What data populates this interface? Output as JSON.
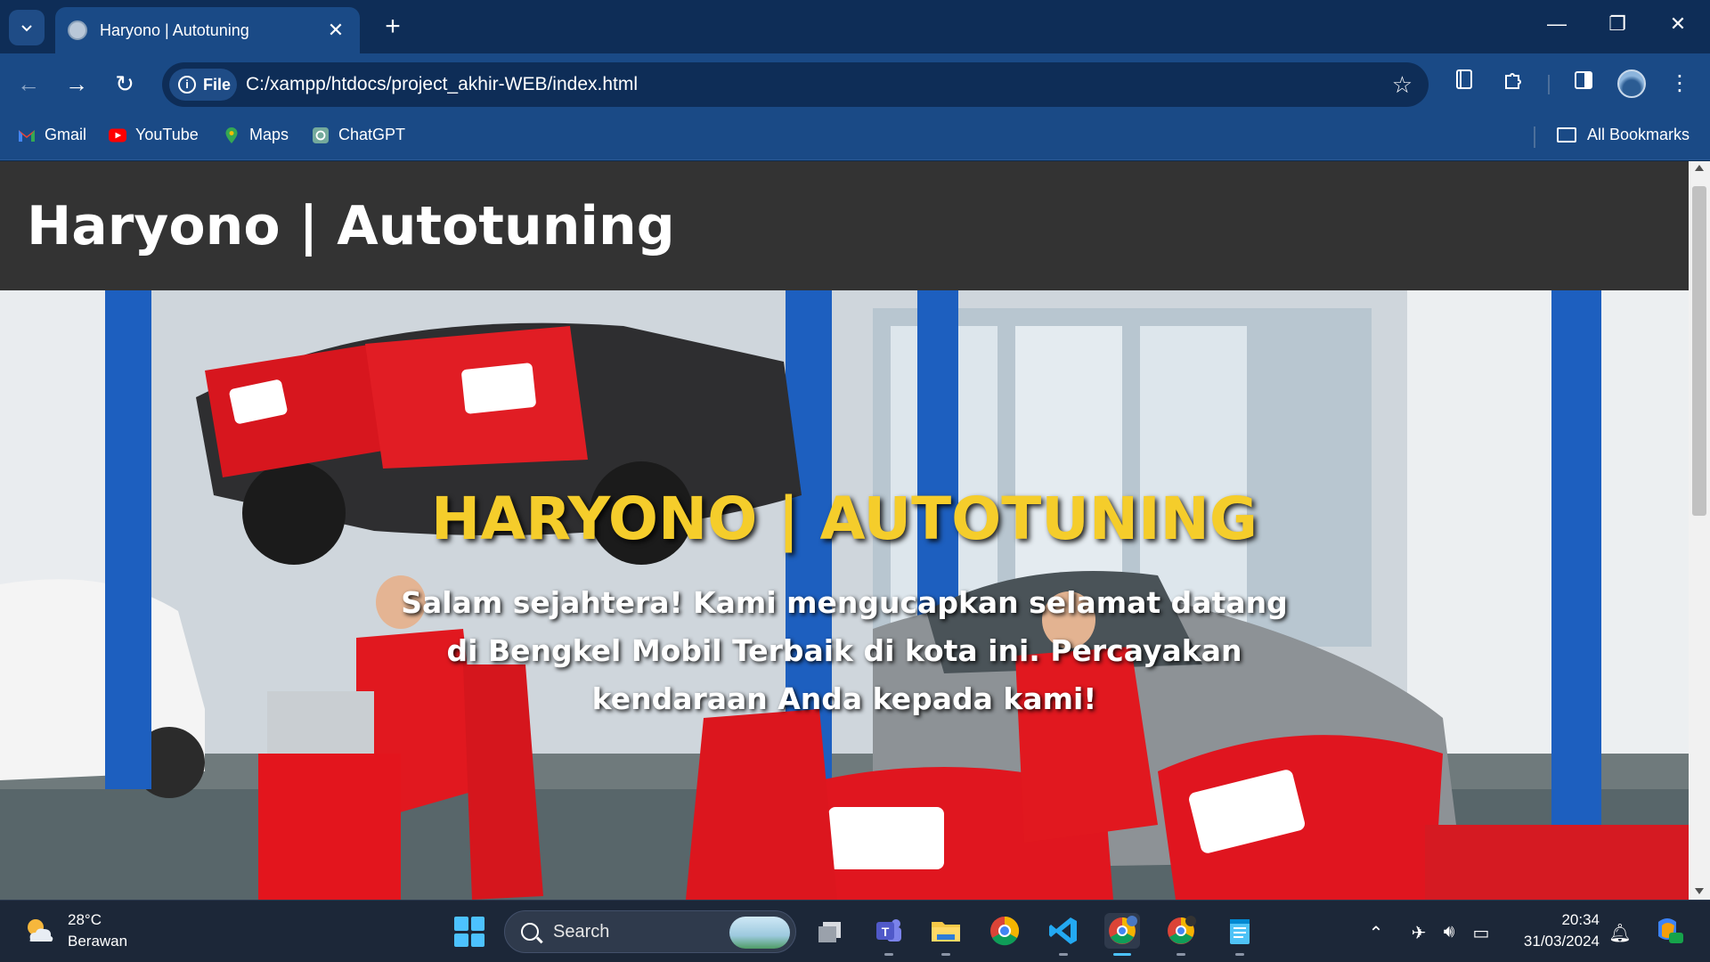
{
  "browser": {
    "tab_title": "Haryono | Autotuning",
    "tab_close": "✕",
    "new_tab": "+",
    "window_controls": {
      "minimize": "—",
      "restore": "❐",
      "close": "✕"
    },
    "site_chip_label": "File",
    "url": "C:/xampp/htdocs/project_akhir-WEB/index.html",
    "icons": [
      "tab-search-icon",
      "back-icon",
      "forward-icon",
      "reload-icon",
      "site-info-icon",
      "bookmark-star-icon",
      "reading-list-icon",
      "extensions-icon",
      "side-panel-icon",
      "profile-avatar",
      "menu-icon"
    ]
  },
  "bookmarks": {
    "items": [
      {
        "label": "Gmail",
        "icon": "gmail-icon",
        "color": "#ea4335"
      },
      {
        "label": "YouTube",
        "icon": "youtube-icon",
        "color": "#ff0000"
      },
      {
        "label": "Maps",
        "icon": "maps-icon",
        "color": "#34a853"
      },
      {
        "label": "ChatGPT",
        "icon": "chatgpt-icon",
        "color": "#74aa9c"
      }
    ],
    "all_bookmarks": "All Bookmarks"
  },
  "page": {
    "header_title": "Haryono | Autotuning",
    "hero_title": "HARYONO | AUTOTUNING",
    "hero_text": "Salam sejahtera! Kami mengucapkan selamat datang di Bengkel Mobil Terbaik di kota ini. Percayakan kendaraan Anda kepada kami!",
    "colors": {
      "header_bg": "#333333",
      "hero_title": "#f5cd2b",
      "hero_text": "#ffffff"
    }
  },
  "taskbar": {
    "weather_temp": "28°C",
    "weather_desc": "Berawan",
    "search_label": "Search",
    "apps": [
      "start-icon",
      "task-view-icon",
      "teams-icon",
      "file-explorer-icon",
      "chrome-icon",
      "vscode-icon",
      "chrome-profile-icon",
      "chrome-profile-2-icon",
      "notepad-icon"
    ],
    "time": "20:34",
    "date": "31/03/2024"
  }
}
